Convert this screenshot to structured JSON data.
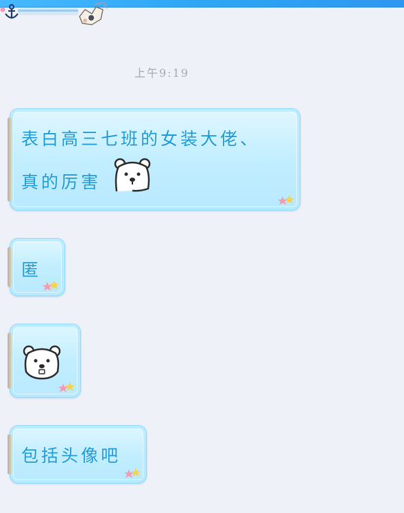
{
  "chat": {
    "timestamp": "上午9:19",
    "messages": [
      {
        "line1": "表白高三七班的女装大佬、",
        "line2": "真的厉害",
        "sticker": "polar-bear-icon"
      },
      {
        "text": "匿"
      },
      {
        "sticker": "polar-bear-icon"
      },
      {
        "text": "包括头像吧"
      }
    ]
  },
  "colors": {
    "bubble_text": "#1c9ad6",
    "bubble_border": "#8fd9fb",
    "background": "#eef1f7",
    "top_bar": "#2ea6f5"
  }
}
